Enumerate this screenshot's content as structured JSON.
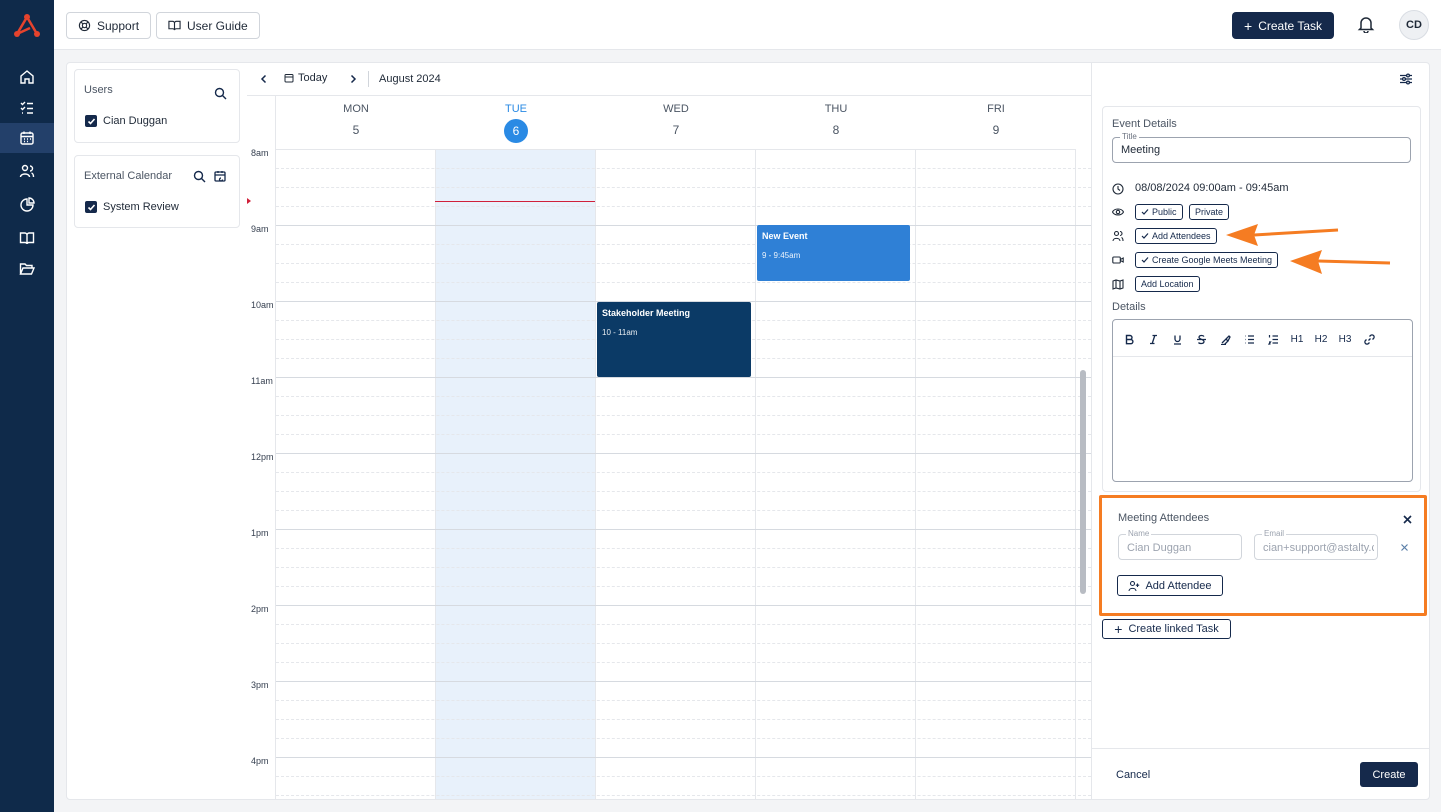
{
  "topbar": {
    "support_label": "Support",
    "guide_label": "User Guide",
    "create_task_label": "Create Task",
    "avatar_initials": "CD"
  },
  "sidebar": {
    "items": [
      {
        "icon": "home-icon"
      },
      {
        "icon": "task-list-icon"
      },
      {
        "icon": "calendar-icon",
        "active": true
      },
      {
        "icon": "users-icon"
      },
      {
        "icon": "pie-chart-icon"
      },
      {
        "icon": "book-icon"
      },
      {
        "icon": "folder-open-icon"
      }
    ]
  },
  "filters": {
    "users_title": "Users",
    "users": [
      {
        "label": "Cian Duggan",
        "checked": true
      }
    ],
    "external_title": "External Calendar",
    "external": [
      {
        "label": "System Review",
        "checked": true
      }
    ]
  },
  "calendar": {
    "today_label": "Today",
    "month_label": "August 2024",
    "days": [
      {
        "name": "MON",
        "num": "5"
      },
      {
        "name": "TUE",
        "num": "6",
        "today": true
      },
      {
        "name": "WED",
        "num": "7"
      },
      {
        "name": "THU",
        "num": "8"
      },
      {
        "name": "FRI",
        "num": "9"
      }
    ],
    "time_labels": [
      "8am",
      "9am",
      "10am",
      "11am",
      "12pm",
      "1pm",
      "2pm",
      "3pm",
      "4pm"
    ],
    "events": [
      {
        "title": "New Event",
        "time": "9 - 9:45am",
        "day": "THU",
        "color": "#2f80d6"
      },
      {
        "title": "Stakeholder Meeting",
        "time": "10 - 11am",
        "day": "WED",
        "color": "#0b3a66"
      }
    ]
  },
  "event_details": {
    "section_label": "Event Details",
    "title_label": "Title",
    "title_value": "Meeting",
    "datetime": "08/08/2024 09:00am - 09:45am",
    "visibility": [
      "Public",
      "Private"
    ],
    "add_attendees_label": "Add Attendees",
    "google_meets_label": "Create Google Meets Meeting",
    "add_location_label": "Add Location",
    "details_label": "Details",
    "toolbar": [
      "B",
      "I",
      "U",
      "S",
      "highlight",
      "bullet-list",
      "ordered-list",
      "H1",
      "H2",
      "H3",
      "link"
    ]
  },
  "attendees": {
    "title": "Meeting Attendees",
    "name_label": "Name",
    "name_value": "Cian Duggan",
    "email_label": "Email",
    "email_value": "cian+support@astalty.c",
    "add_label": "Add Attendee"
  },
  "footer": {
    "linked_task_label": "Create linked Task",
    "cancel_label": "Cancel",
    "create_label": "Create"
  },
  "colors": {
    "navy": "#15294b",
    "today_blue": "#2a8ae4",
    "annotation_orange": "#f57c22",
    "now_line": "#d0203a"
  }
}
